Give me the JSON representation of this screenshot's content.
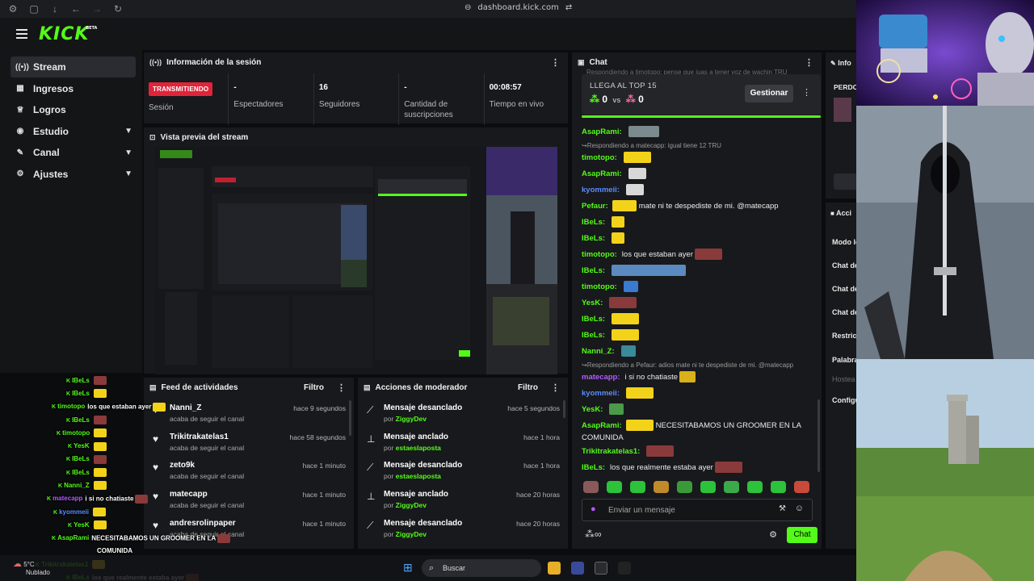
{
  "browser": {
    "url": "dashboard.kick.com"
  },
  "brand": {
    "logo": "KICK",
    "badge": "BETA",
    "accent": "#53fc18"
  },
  "sidebar": {
    "items": [
      {
        "label": "Stream",
        "icon": "broadcast-icon",
        "active": true
      },
      {
        "label": "Ingresos",
        "icon": "chart-icon"
      },
      {
        "label": "Logros",
        "icon": "trophy-icon"
      },
      {
        "label": "Estudio",
        "icon": "studio-icon",
        "expandable": true
      },
      {
        "label": "Canal",
        "icon": "channel-icon",
        "expandable": true
      },
      {
        "label": "Ajustes",
        "icon": "gear-icon",
        "expandable": true
      }
    ]
  },
  "session": {
    "title": "Información de la sesión",
    "badge": "TRANSMITIENDO",
    "cells": [
      {
        "value": "",
        "label": "Sesión"
      },
      {
        "value": "-",
        "label": "Espectadores"
      },
      {
        "value": "16",
        "label": "Seguidores"
      },
      {
        "value": "-",
        "label": "Cantidad de suscripciones"
      },
      {
        "value": "00:08:57",
        "label": "Tiempo en vivo"
      }
    ]
  },
  "preview": {
    "title": "Vista previa del stream"
  },
  "feed": {
    "title": "Feed de actividades",
    "filter": "Filtro",
    "items": [
      {
        "name": "Nanni_Z",
        "sub": "acaba de seguir el canal",
        "time": "hace 9 segundos"
      },
      {
        "name": "Trikitrakatelas1",
        "sub": "acaba de seguir el canal",
        "time": "hace 58 segundos"
      },
      {
        "name": "zeto9k",
        "sub": "acaba de seguir el canal",
        "time": "hace 1 minuto"
      },
      {
        "name": "matecapp",
        "sub": "acaba de seguir el canal",
        "time": "hace 1 minuto"
      },
      {
        "name": "andresrolinpaper",
        "sub": "acaba de seguir el canal",
        "time": "hace 1 minuto"
      }
    ]
  },
  "mod": {
    "title": "Acciones de moderador",
    "filter": "Filtro",
    "por": "por",
    "items": [
      {
        "action": "Mensaje desanclado",
        "by": "ZiggyDev",
        "time": "hace 5 segundos",
        "icon": "unpin-icon"
      },
      {
        "action": "Mensaje anclado",
        "by": "estaeslaposta",
        "time": "hace 1 hora",
        "icon": "pin-icon"
      },
      {
        "action": "Mensaje desanclado",
        "by": "estaeslaposta",
        "time": "hace 1 hora",
        "icon": "unpin-icon"
      },
      {
        "action": "Mensaje anclado",
        "by": "ZiggyDev",
        "time": "hace 20 horas",
        "icon": "pin-icon"
      },
      {
        "action": "Mensaje desanclado",
        "by": "ZiggyDev",
        "time": "hace 20 horas",
        "icon": "unpin-icon"
      }
    ]
  },
  "chat": {
    "title": "Chat",
    "ghost": "Respondiendo a timotopo: pense que iuas a tener voz de wachin TRU",
    "top_label": "LLEGA AL TOP 15",
    "score_a": "0",
    "vs": "vs",
    "score_b": "0",
    "manage": "Gestionar",
    "messages": [
      {
        "user": "AsapRami:",
        "color": "#53fc18",
        "text": "",
        "emote": 38,
        "ecolor": "#7a8a8f"
      },
      {
        "reply": "Respondiendo a matecapp: igual tiene 12 TRU"
      },
      {
        "user": "timotopo:",
        "color": "#53fc18",
        "text": "",
        "emote": 34,
        "ecolor": "#f3d21a"
      },
      {
        "user": "AsapRami:",
        "color": "#53fc18",
        "text": "",
        "emote": 22,
        "ecolor": "#d8d8d8"
      },
      {
        "user": "kyommeii:",
        "color": "#5a8cff",
        "text": "",
        "emote": 22,
        "ecolor": "#d8d8d8"
      },
      {
        "user": "Pefaur:",
        "color": "#53fc18",
        "text": "mate ni te despediste de mi. @matecapp",
        "emote": 30,
        "ecolor": "#f3d21a",
        "prefix": true
      },
      {
        "user": "IBeLs:",
        "color": "#53fc18",
        "text": "",
        "emote": 16,
        "ecolor": "#f3d21a"
      },
      {
        "user": "IBeLs:",
        "color": "#53fc18",
        "text": "",
        "emote": 16,
        "ecolor": "#f3d21a"
      },
      {
        "user": "timotopo:",
        "color": "#53fc18",
        "text": "los que estaban ayer",
        "emote": 34,
        "ecolor": "#8a3a3a"
      },
      {
        "user": "IBeLs:",
        "color": "#53fc18",
        "text": "",
        "emote": 92,
        "ecolor": "#5a8ac0"
      },
      {
        "user": "timotopo:",
        "color": "#53fc18",
        "text": "",
        "emote": 18,
        "ecolor": "#3a7ad0"
      },
      {
        "user": "YesK:",
        "color": "#53fc18",
        "text": "",
        "emote": 34,
        "ecolor": "#8a3a3a"
      },
      {
        "user": "IBeLs:",
        "color": "#53fc18",
        "text": "",
        "emote": 34,
        "ecolor": "#f3d21a"
      },
      {
        "user": "IBeLs:",
        "color": "#53fc18",
        "text": "",
        "emote": 34,
        "ecolor": "#f3d21a"
      },
      {
        "user": "Nanni_Z:",
        "color": "#53fc18",
        "text": "",
        "emote": 18,
        "ecolor": "#3a8a9a"
      },
      {
        "reply": "Respondiendo a Pefaur: adios mate ni te despediste de mi. @matecapp"
      },
      {
        "user": "matecapp:",
        "color": "#b25cff",
        "text": "i si no chatiaste",
        "emote": 20,
        "ecolor": "#d8b01a"
      },
      {
        "user": "kyommeii:",
        "color": "#5a8cff",
        "text": "",
        "emote": 34,
        "ecolor": "#f3d21a"
      },
      {
        "user": "YesK:",
        "color": "#53fc18",
        "text": "",
        "emote": 18,
        "ecolor": "#4a9a4a"
      },
      {
        "user": "AsapRami:",
        "color": "#53fc18",
        "text": "NECESITABAMOS UN GROOMER EN LA",
        "emote": 34,
        "ecolor": "#f3d21a"
      },
      {
        "cont": "COMUNIDA"
      },
      {
        "user": "Trikitrakatelas1:",
        "color": "#53fc18",
        "text": "",
        "emote": 34,
        "ecolor": "#8a3a3a"
      },
      {
        "user": "IBeLs:",
        "color": "#53fc18",
        "text": "los que realmente estaba ayer",
        "emote": 34,
        "ecolor": "#8a3a3a"
      }
    ],
    "input_placeholder": "Enviar un mensaje",
    "send": "Chat"
  },
  "right_panel": {
    "info_label": "Info",
    "pinned_label": "PERDO",
    "actions_label": "Acci",
    "rows": [
      "Modo le",
      "Chat de",
      "Chat de",
      "Chat de",
      "Restric",
      "Palabra",
      "Hostea",
      "Configu"
    ]
  },
  "overlay": {
    "rows": [
      {
        "user": "IBeLs",
        "text": "",
        "color": "#53fc18"
      },
      {
        "user": "IBeLs",
        "text": "",
        "color": "#53fc18"
      },
      {
        "user": "timotopo",
        "text": "los que estaban ayer",
        "color": "#53fc18"
      },
      {
        "user": "IBeLs",
        "text": "",
        "color": "#53fc18"
      },
      {
        "user": "timotopo",
        "text": "",
        "color": "#53fc18"
      },
      {
        "user": "YesK",
        "text": "",
        "color": "#53fc18"
      },
      {
        "user": "IBeLs",
        "text": "",
        "color": "#53fc18"
      },
      {
        "user": "IBeLs",
        "text": "",
        "color": "#53fc18"
      },
      {
        "user": "Nanni_Z",
        "text": "",
        "color": "#53fc18"
      },
      {
        "user": "matecapp",
        "text": "i si no chatiaste",
        "color": "#b25cff"
      },
      {
        "user": "kyommeii",
        "text": "",
        "color": "#5a8cff"
      },
      {
        "user": "YesK",
        "text": "",
        "color": "#53fc18"
      },
      {
        "user": "AsapRami",
        "text": "NECESITABAMOS UN GROOMER EN LA",
        "color": "#53fc18"
      },
      {
        "user": "",
        "text": "COMUNIDA",
        "color": "#53fc18"
      },
      {
        "user": "Trikitrakatelas1",
        "text": "",
        "color": "#53fc18"
      },
      {
        "user": "IBeLs",
        "text": "los que realmente estaba ayer",
        "color": "#53fc18"
      }
    ]
  },
  "taskbar": {
    "temp": "5°C",
    "weather": "Nublado",
    "search": "Buscar"
  }
}
